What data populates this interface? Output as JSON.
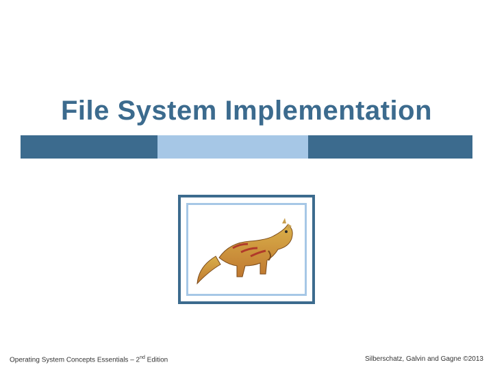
{
  "title": "File System Implementation",
  "footer": {
    "left_a": "Operating System Concepts Essentials – 2",
    "left_sup": "nd",
    "left_b": " Edition",
    "right": "Silberschatz, Galvin and Gagne ©2013"
  }
}
